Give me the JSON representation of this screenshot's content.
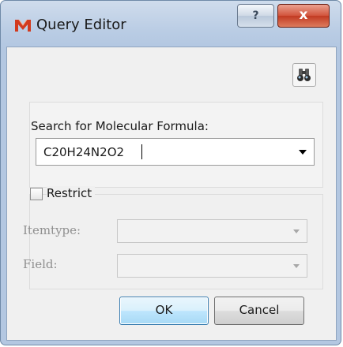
{
  "window": {
    "title": "Query Editor",
    "help_glyph": "?",
    "close_glyph": "x"
  },
  "icons": {
    "app": "m-logo-icon",
    "tool": "binoculars-icon"
  },
  "search": {
    "label": "Search for Molecular Formula:",
    "value": "C20H24N2O2"
  },
  "restrict": {
    "label": "Restrict",
    "checked": false,
    "itemtype_label": "Itemtype:",
    "itemtype_value": "",
    "field_label": "Field:",
    "field_value": ""
  },
  "buttons": {
    "ok": "OK",
    "cancel": "Cancel"
  },
  "colors": {
    "app_icon": "#d23a1e",
    "close_button": "#c23a22",
    "ok_border": "#3c7fb1"
  }
}
